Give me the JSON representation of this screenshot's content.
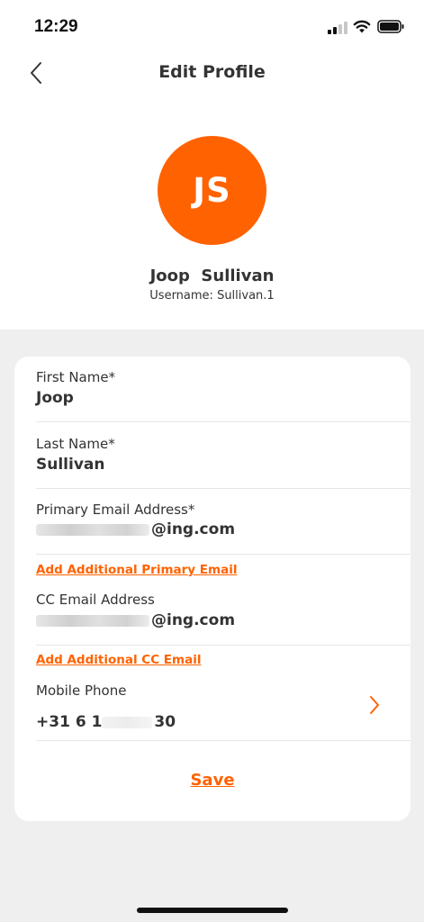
{
  "status_bar": {
    "time": "12:29"
  },
  "header": {
    "title": "Edit Profile"
  },
  "profile": {
    "initials": "JS",
    "full_name": "Joop  Sullivan",
    "username": "Username: Sullivan.1"
  },
  "form": {
    "first_name": {
      "label": "First Name*",
      "value": "Joop"
    },
    "last_name": {
      "label": "Last Name*",
      "value": "Sullivan"
    },
    "primary_email": {
      "label": "Primary Email Address*",
      "value_suffix": "@ing.com"
    },
    "add_primary_email": "Add Additional Primary Email",
    "cc_email": {
      "label": "CC Email Address",
      "value_suffix": "@ing.com"
    },
    "add_cc_email": "Add Additional CC Email",
    "mobile_phone": {
      "label": "Mobile Phone",
      "value_prefix": "+31 6 1",
      "value_suffix": "30"
    },
    "save_label": "Save"
  },
  "colors": {
    "accent": "#ff6200",
    "text": "#333333",
    "background": "#efefef",
    "card": "#ffffff"
  },
  "icons": [
    "back-chevron-icon",
    "signal-icon",
    "wifi-icon",
    "battery-icon",
    "chevron-right-icon"
  ]
}
